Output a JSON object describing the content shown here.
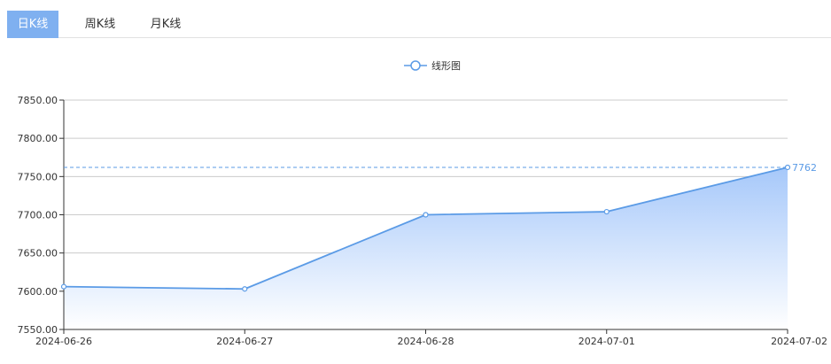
{
  "tabs": [
    {
      "label": "日K线",
      "active": true
    },
    {
      "label": "周K线",
      "active": false
    },
    {
      "label": "月K线",
      "active": false
    }
  ],
  "colors": {
    "accent": "#7fb0f0",
    "line": "#5b9be6",
    "area_top": "#a6c8fa",
    "area_bottom": "#ffffff",
    "grid": "#cccccc",
    "axis": "#333333"
  },
  "chart_data": {
    "type": "area",
    "legend": "线形图",
    "legend_position": "top-center",
    "categories": [
      "2024-06-26",
      "2024-06-27",
      "2024-06-28",
      "2024-07-01",
      "2024-07-02"
    ],
    "series": [
      {
        "name": "线形图",
        "values": [
          7606,
          7603,
          7700,
          7704,
          7762
        ]
      }
    ],
    "ylim": [
      7550,
      7850
    ],
    "yticks": [
      "7550.00",
      "7600.00",
      "7650.00",
      "7700.00",
      "7750.00",
      "7800.00",
      "7850.00"
    ],
    "ytick_values": [
      7550,
      7600,
      7650,
      7700,
      7750,
      7800,
      7850
    ],
    "markline": {
      "value": 7762,
      "label": "7762"
    },
    "grid": true
  }
}
